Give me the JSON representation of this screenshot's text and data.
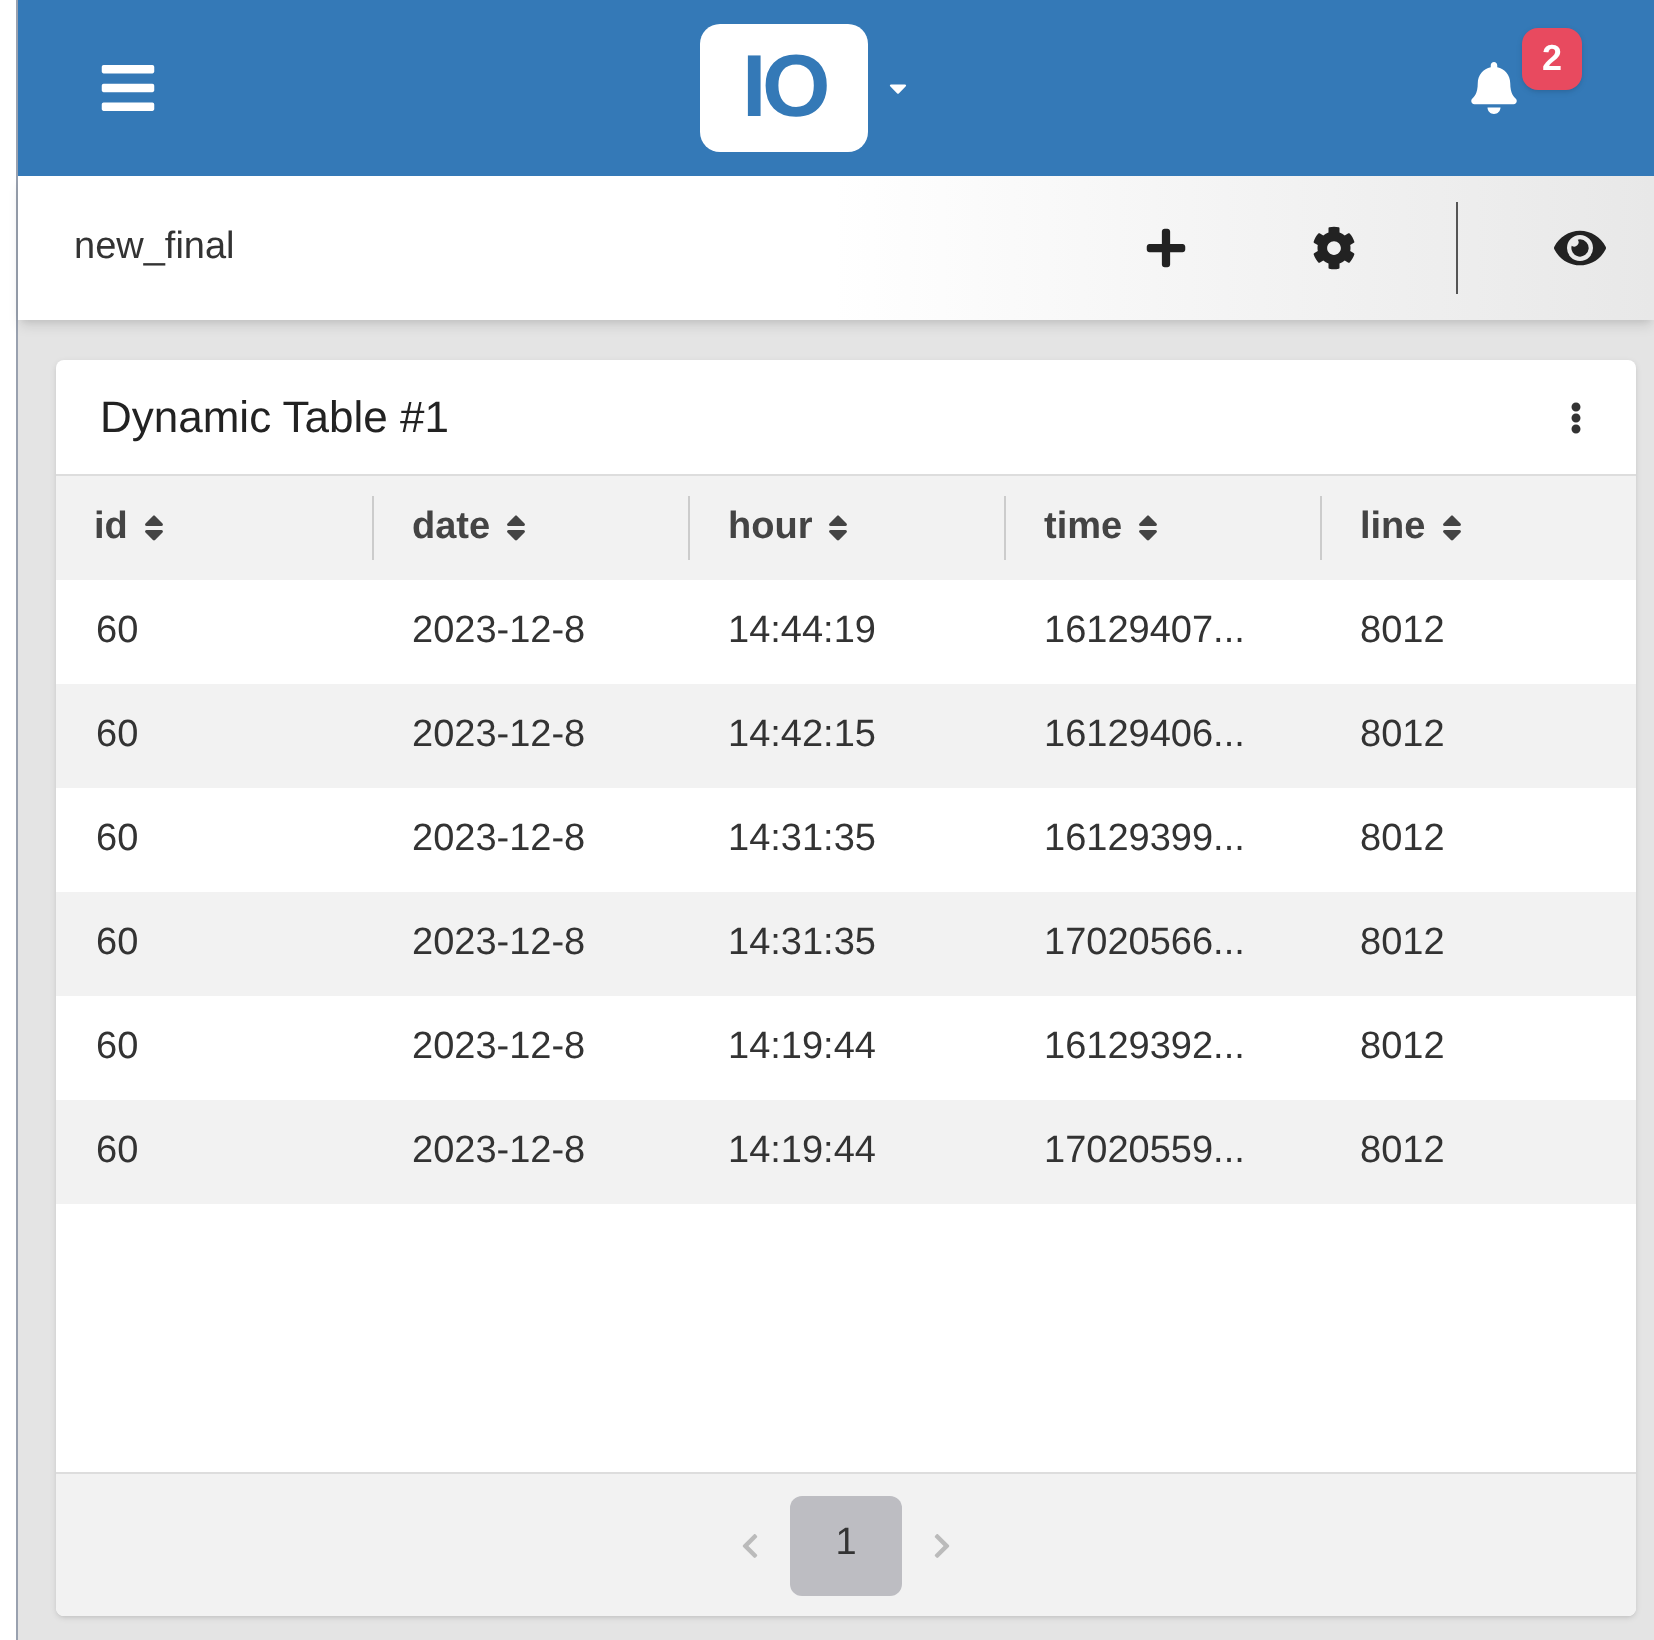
{
  "header": {
    "logo": "IO",
    "notification_count": "2"
  },
  "toolbar": {
    "title": "new_final"
  },
  "card": {
    "title": "Dynamic Table #1",
    "columns": [
      "id",
      "date",
      "hour",
      "time",
      "line"
    ],
    "rows": [
      [
        "60",
        "2023-12-8",
        "14:44:19",
        "16129407...",
        "8012"
      ],
      [
        "60",
        "2023-12-8",
        "14:42:15",
        "16129406...",
        "8012"
      ],
      [
        "60",
        "2023-12-8",
        "14:31:35",
        "16129399...",
        "8012"
      ],
      [
        "60",
        "2023-12-8",
        "14:31:35",
        "17020566...",
        "8012"
      ],
      [
        "60",
        "2023-12-8",
        "14:19:44",
        "16129392...",
        "8012"
      ],
      [
        "60",
        "2023-12-8",
        "14:19:44",
        "17020559...",
        "8012"
      ]
    ],
    "pagination": [
      {
        "label": "1",
        "selected": true
      }
    ]
  }
}
